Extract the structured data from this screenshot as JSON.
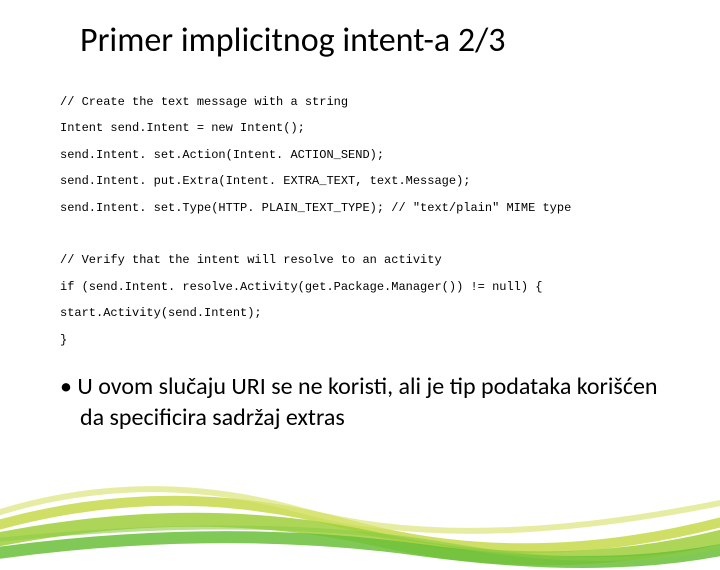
{
  "title": "Primer implicitnog intent-a 2/3",
  "code": {
    "l1": "// Create the text message with a string",
    "l2": "Intent send.Intent = new Intent();",
    "l3": "send.Intent. set.Action(Intent. ACTION_SEND);",
    "l4": "send.Intent. put.Extra(Intent. EXTRA_TEXT, text.Message);",
    "l5": "send.Intent. set.Type(HTTP. PLAIN_TEXT_TYPE); // \"text/plain\" MIME type",
    "l6": "// Verify that the intent will resolve to an activity",
    "l7": "if (send.Intent. resolve.Activity(get.Package.Manager()) != null) {",
    "l8": "    start.Activity(send.Intent);",
    "l9": "}"
  },
  "bullet": "U ovom slučaju URI se ne koristi, ali je tip podataka korišćen da specificira sadržaj extras"
}
